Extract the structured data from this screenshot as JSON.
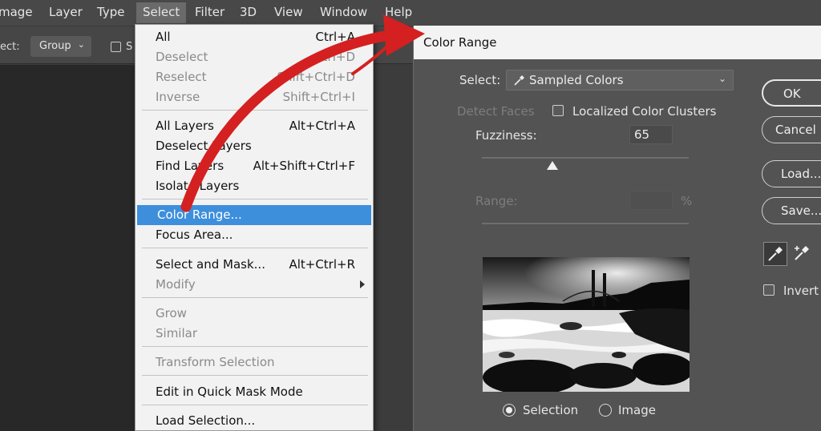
{
  "menubar": {
    "items": [
      "mage",
      "Layer",
      "Type",
      "Select",
      "Filter",
      "3D",
      "View",
      "Window",
      "Help"
    ],
    "active": "Select"
  },
  "options_bar": {
    "label": "ect:",
    "group_value": "Group",
    "checkbox_label": "S"
  },
  "select_menu": {
    "items": [
      {
        "label": "All",
        "shortcut": "Ctrl+A",
        "disabled": false
      },
      {
        "label": "Deselect",
        "shortcut": "Ctrl+D",
        "disabled": true
      },
      {
        "label": "Reselect",
        "shortcut": "Shift+Ctrl+D",
        "disabled": true
      },
      {
        "label": "Inverse",
        "shortcut": "Shift+Ctrl+I",
        "disabled": true
      },
      {
        "label": "All Layers",
        "shortcut": "Alt+Ctrl+A",
        "disabled": false
      },
      {
        "label": "Deselect Layers",
        "shortcut": "",
        "disabled": false
      },
      {
        "label": "Find Layers",
        "shortcut": "Alt+Shift+Ctrl+F",
        "disabled": false
      },
      {
        "label": "Isolate Layers",
        "shortcut": "",
        "disabled": false
      },
      {
        "label": "Color Range...",
        "shortcut": "",
        "disabled": false,
        "highlighted": true
      },
      {
        "label": "Focus Area...",
        "shortcut": "",
        "disabled": false
      },
      {
        "label": "Select and Mask...",
        "shortcut": "Alt+Ctrl+R",
        "disabled": false
      },
      {
        "label": "Modify",
        "shortcut": "",
        "disabled": true,
        "submenu": true
      },
      {
        "label": "Grow",
        "shortcut": "",
        "disabled": true
      },
      {
        "label": "Similar",
        "shortcut": "",
        "disabled": true
      },
      {
        "label": "Transform Selection",
        "shortcut": "",
        "disabled": true
      },
      {
        "label": "Edit in Quick Mask Mode",
        "shortcut": "",
        "disabled": false
      },
      {
        "label": "Load Selection...",
        "shortcut": "",
        "disabled": false
      }
    ]
  },
  "dialog": {
    "title": "Color Range",
    "select_label": "Select:",
    "select_value": "Sampled Colors",
    "detect_faces_label": "Detect Faces",
    "localized_label": "Localized Color Clusters",
    "fuzziness_label": "Fuzziness:",
    "fuzziness_value": "65",
    "fuzziness_fraction": 0.34,
    "range_label": "Range:",
    "range_unit": "%",
    "radio_selection": "Selection",
    "radio_image": "Image",
    "buttons": {
      "ok": "OK",
      "cancel": "Cancel",
      "load": "Load...",
      "save": "Save..."
    },
    "invert_label": "Invert"
  },
  "colors": {
    "highlight": "#3d8fdc",
    "annotation_arrow": "#d42020"
  },
  "icons": [
    "eyedropper-icon",
    "eyedropper-plus-icon",
    "chevron-down-icon",
    "submenu-arrow-icon"
  ]
}
